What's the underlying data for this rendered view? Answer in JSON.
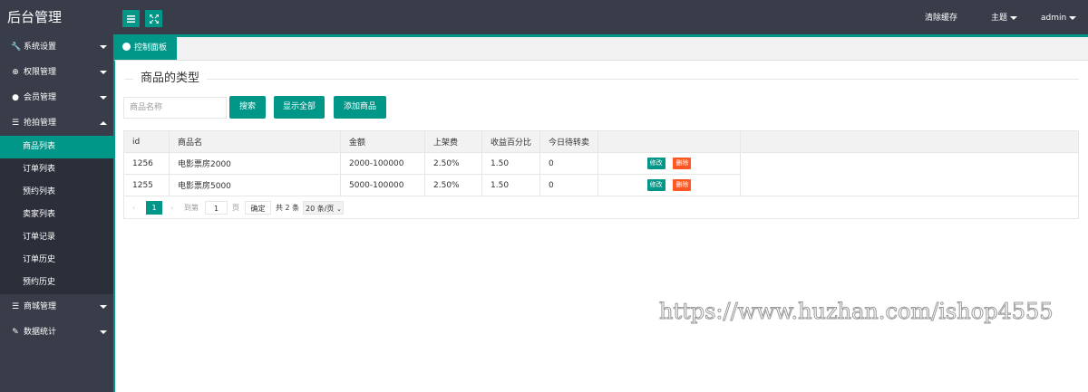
{
  "header": {
    "title": "后台管理",
    "clear_cache": "清除缓存",
    "theme": "主题",
    "user": "admin"
  },
  "sidebar": {
    "items": [
      {
        "label": "系统设置",
        "icon": "wrench-icon"
      },
      {
        "label": "权限管理",
        "icon": "globe-icon"
      },
      {
        "label": "会员管理",
        "icon": "user-icon"
      },
      {
        "label": "抢拍管理",
        "icon": "list-icon"
      }
    ],
    "sub_items": [
      "商品列表",
      "订单列表",
      "预约列表",
      "卖家列表",
      "订单记录",
      "订单历史",
      "预约历史"
    ],
    "bottom_items": [
      {
        "label": "商城管理",
        "icon": "list-icon"
      },
      {
        "label": "数据统计",
        "icon": "pen-icon"
      }
    ]
  },
  "tabs": [
    {
      "label": "控制面板",
      "icon": "dashboard-icon"
    }
  ],
  "main": {
    "section_title": "商品的类型",
    "search_placeholder": "商品名称",
    "buttons": {
      "search": "搜索",
      "show_all": "显示全部",
      "add": "添加商品"
    }
  },
  "table": {
    "headers": [
      "id",
      "商品名",
      "金额",
      "上架费",
      "收益百分比",
      "今日待转卖",
      ""
    ],
    "rows": [
      {
        "id": "1256",
        "name": "电影票房2000",
        "amount": "2000-100000",
        "fee": "2.50%",
        "ratio": "1.50",
        "today": "0",
        "edit": "修改",
        "delete": "删除"
      },
      {
        "id": "1255",
        "name": "电影票房5000",
        "amount": "5000-100000",
        "fee": "2.50%",
        "ratio": "1.50",
        "today": "0",
        "edit": "修改",
        "delete": "删除"
      }
    ]
  },
  "pager": {
    "current": "1",
    "goto_label": "到第",
    "page_value": "1",
    "page_unit": "页",
    "confirm": "确定",
    "total": "共 2 条",
    "page_size": "20 条/页"
  },
  "watermark": "https://www.huzhan.com/ishop4555",
  "colors": {
    "accent": "#009688",
    "sidebar": "#393d49",
    "danger": "#ff5722"
  }
}
